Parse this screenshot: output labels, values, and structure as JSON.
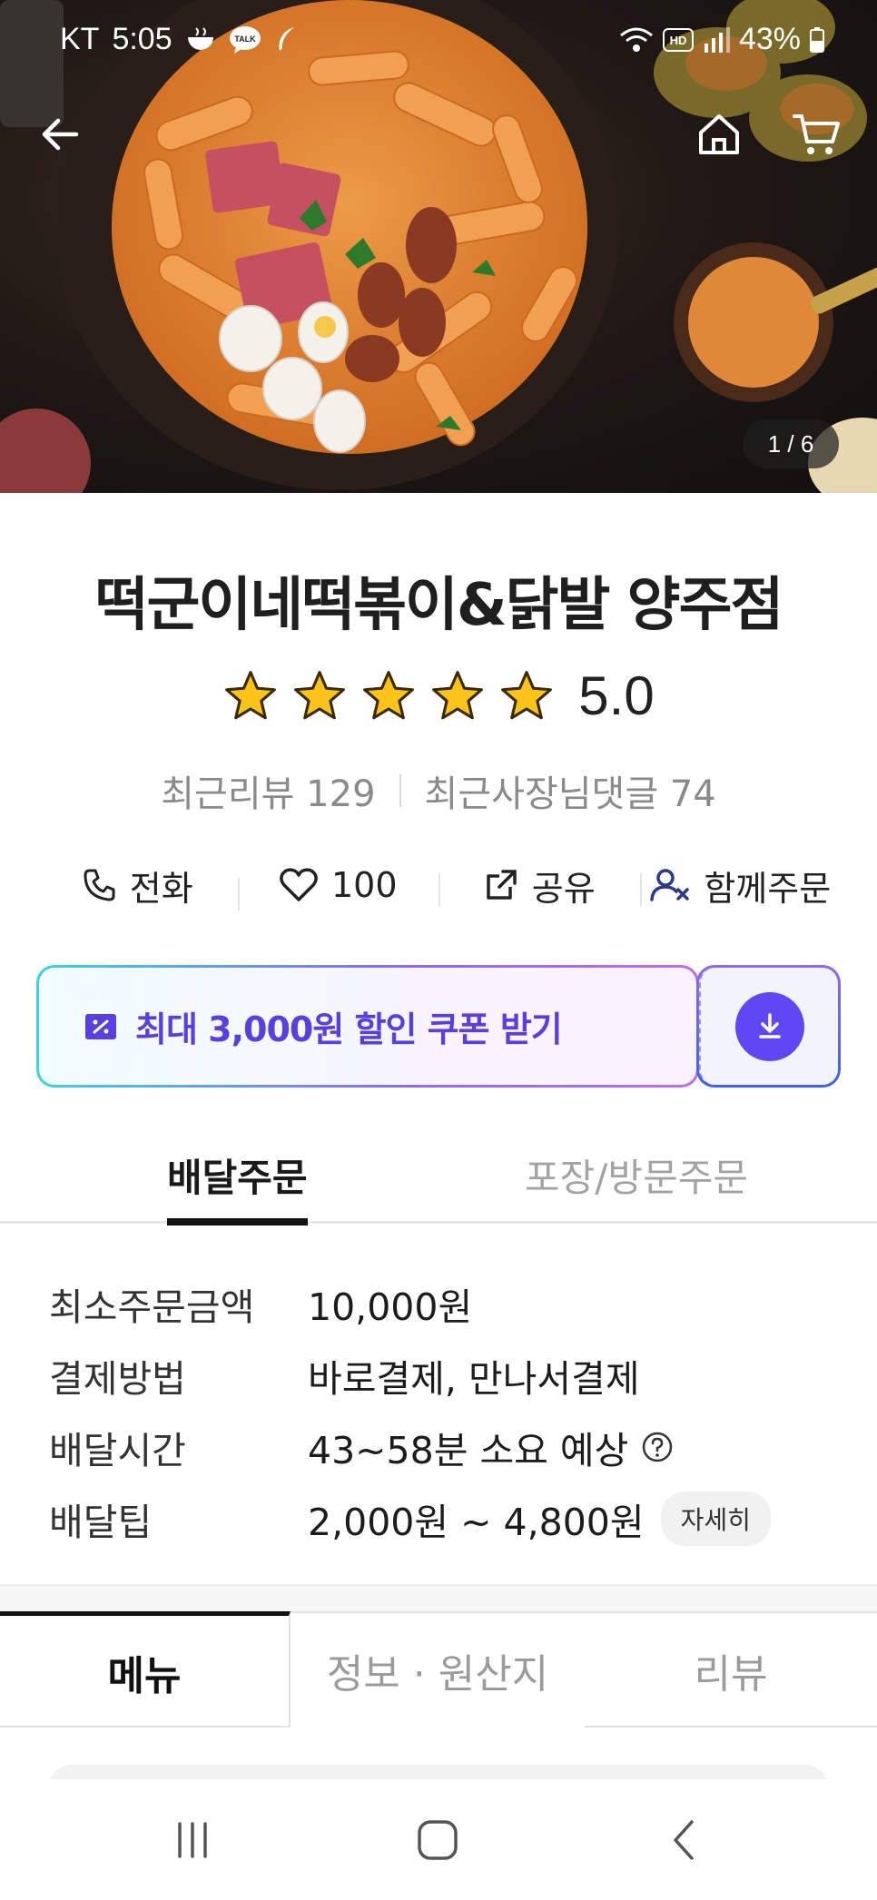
{
  "status_bar": {
    "carrier": "KT",
    "time": "5:05",
    "battery": "43%",
    "left_icons": [
      "bowl-icon",
      "talk-icon",
      "feather-icon"
    ],
    "right_icons": [
      "wifi-icon",
      "hd-icon",
      "signal-icon",
      "battery-icon"
    ],
    "talk_badge": "TALK",
    "hd_badge": "HD"
  },
  "hero": {
    "page_indicator": "1 / 6",
    "back_icon": "back-arrow-icon",
    "home_icon": "home-icon",
    "cart_icon": "cart-icon"
  },
  "store": {
    "name": "떡군이네떡볶이&닭발 양주점",
    "rating": "5.0",
    "stars": 5,
    "recent_reviews": "최근리뷰 129",
    "owner_replies": "최근사장님댓글 74"
  },
  "actions": [
    {
      "label": "전화",
      "icon": "phone-icon"
    },
    {
      "label": "100",
      "icon": "heart-icon"
    },
    {
      "label": "공유",
      "icon": "share-icon"
    },
    {
      "label": "함께주문",
      "icon": "group-order-icon"
    }
  ],
  "coupon": {
    "text": "최대 3,000원 할인 쿠폰 받기",
    "icon": "coupon-icon",
    "download_icon": "download-icon",
    "colors": {
      "accent": "#6047f3",
      "border_start": "#3ed0e6"
    }
  },
  "order_tabs": {
    "delivery": "배달주문",
    "pickup": "포장/방문주문"
  },
  "order_info": {
    "min_order_label": "최소주문금액",
    "min_order_value": "10,000원",
    "payment_label": "결제방법",
    "payment_value": "바로결제, 만나서결제",
    "delivery_time_label": "배달시간",
    "delivery_time_value": "43~58분 소요 예상",
    "delivery_tip_label": "배달팁",
    "delivery_tip_value": "2,000원 ~ 4,800원",
    "detail_button": "자세히"
  },
  "menu_tabs": {
    "menu": "메뉴",
    "info": "정보 · 원산지",
    "review": "리뷰"
  },
  "system_nav": {
    "recents_icon": "recents-icon",
    "home_icon": "system-home-icon",
    "back_icon": "system-back-icon"
  }
}
